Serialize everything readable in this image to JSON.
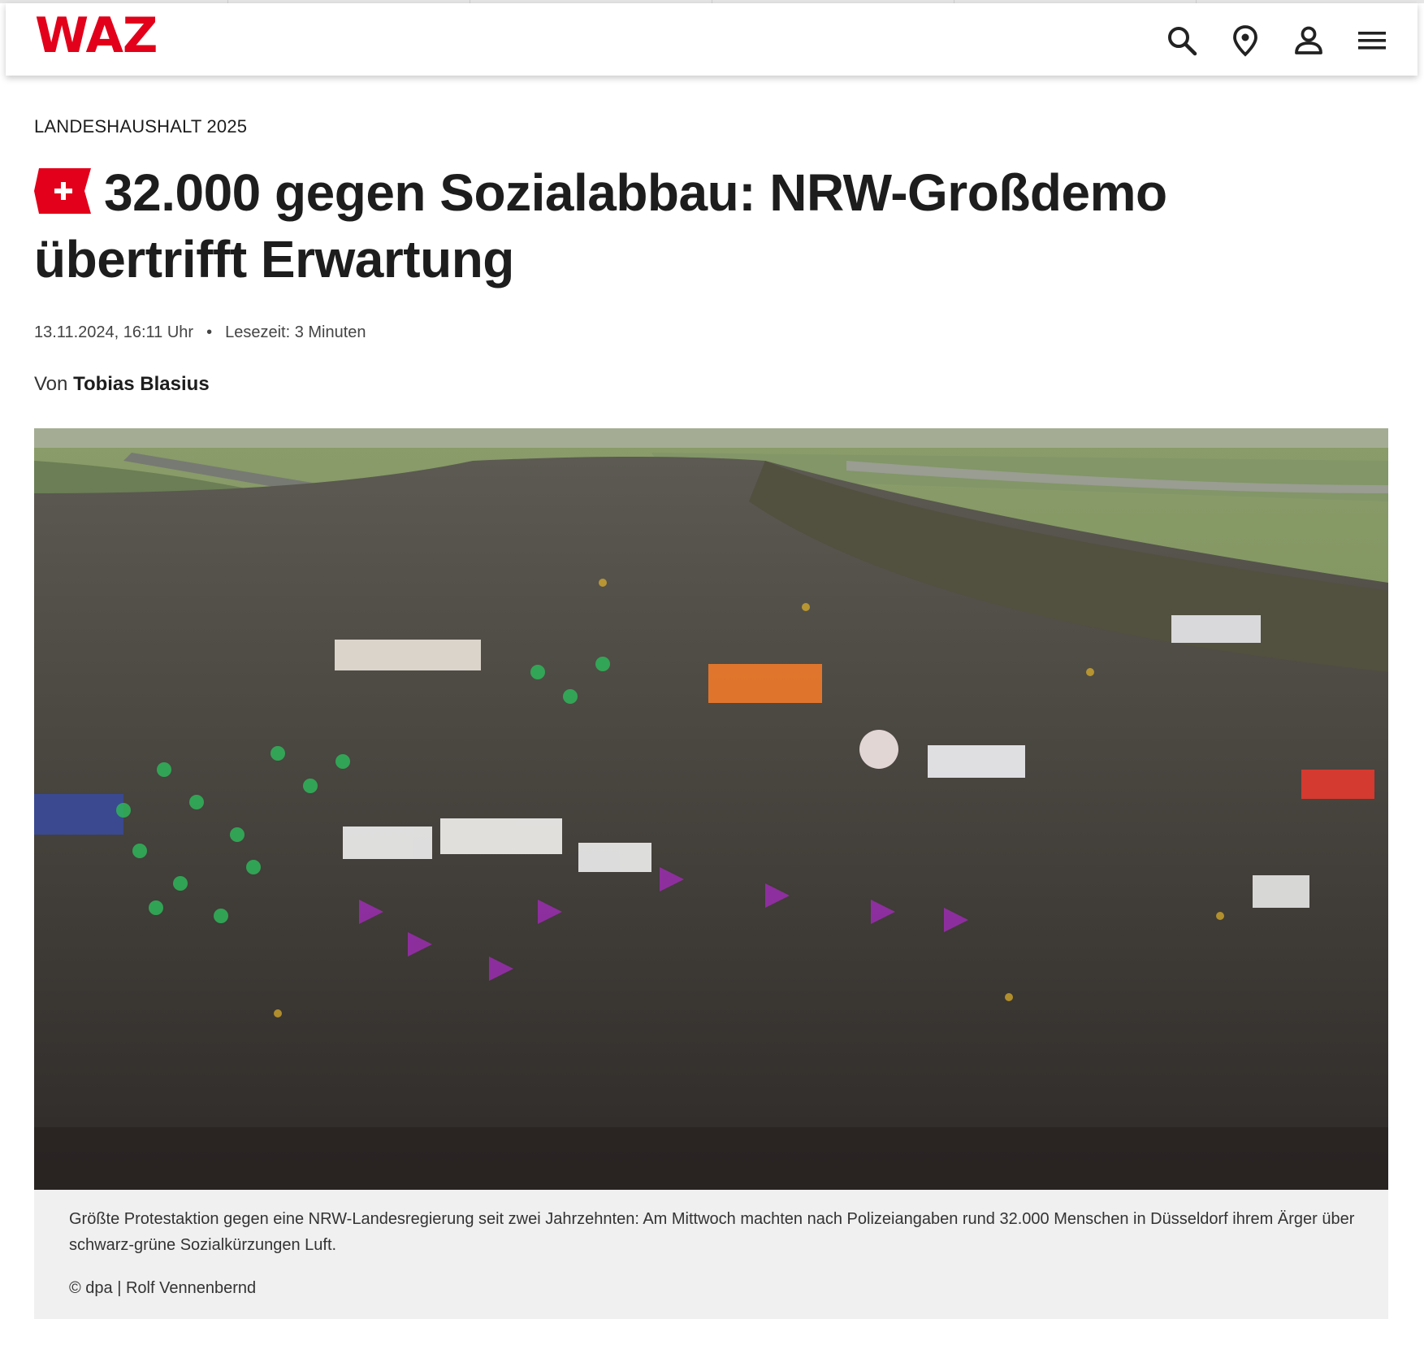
{
  "header": {
    "logo_text": "WAZ",
    "brand_color": "#e2001a",
    "icons": [
      "search-icon",
      "location-pin-icon",
      "user-icon",
      "menu-icon"
    ]
  },
  "article": {
    "kicker": "LANDESHAUSHALT 2025",
    "badge_icon": "plus-badge-icon",
    "headline": "32.000 gegen Sozialabbau: NRW-Großdemo übertrifft Erwartung",
    "date": "13.11.2024, 16:11 Uhr",
    "reading_time": "Lesezeit: 3 Minuten",
    "separator": "•",
    "author_prefix": "Von",
    "author": "Tobias Blasius"
  },
  "image": {
    "caption": "Größte Protestaktion gegen eine NRW-Landesregierung seit zwei Jahrzehnten: Am Mittwoch machten nach Polizeiangaben rund 32.000 Menschen in Düsseldorf ihrem Ärger über schwarz-grüne Sozialkürzungen Luft.",
    "credit": "© dpa | Rolf Vennenbernd"
  }
}
